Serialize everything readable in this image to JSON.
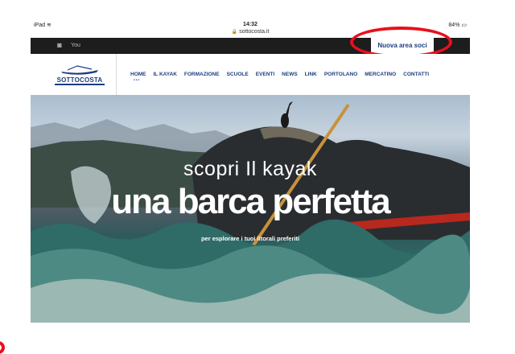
{
  "status": {
    "device": "iPad",
    "time": "14:32",
    "battery": "84%"
  },
  "browser": {
    "url": "sottocosta.it"
  },
  "topbar": {
    "instagram_icon": "instagram-icon",
    "youtube_icon": "youtube-icon",
    "youtube_label": "You",
    "members_button": "Nuova area soci"
  },
  "logo": {
    "text": "SOTTOCOSTA"
  },
  "nav": {
    "items": [
      {
        "label": "HOME"
      },
      {
        "label": "IL KAYAK"
      },
      {
        "label": "FORMAZIONE"
      },
      {
        "label": "SCUOLE"
      },
      {
        "label": "EVENTI"
      },
      {
        "label": "NEWS"
      },
      {
        "label": "LINK"
      },
      {
        "label": "PORTOLANO"
      },
      {
        "label": "MERCATINO"
      },
      {
        "label": "CONTATTI"
      }
    ]
  },
  "hero": {
    "headline": "scopri Il kayak",
    "title": "una barca perfetta",
    "subtitle": "per esplorare i tuoi litorali preferiti"
  },
  "colors": {
    "brand": "#1c3e80",
    "annotation": "#e8101c",
    "topbar": "#1d1d1d"
  }
}
